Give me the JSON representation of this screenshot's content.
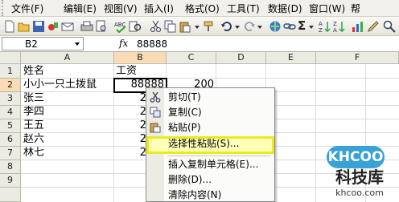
{
  "menubar": {
    "items": [
      {
        "label": "文件(F)",
        "name": "menu-file"
      },
      {
        "label": "编辑(E)",
        "name": "menu-edit"
      },
      {
        "label": "视图(V)",
        "name": "menu-view"
      },
      {
        "label": "插入(I)",
        "name": "menu-insert"
      },
      {
        "label": "格式(O)",
        "name": "menu-format"
      },
      {
        "label": "工具(T)",
        "name": "menu-tools"
      },
      {
        "label": "数据(D)",
        "name": "menu-data"
      },
      {
        "label": "窗口(W)",
        "name": "menu-window"
      },
      {
        "label": "帮",
        "name": "menu-help"
      }
    ]
  },
  "toolbar": {
    "icons": [
      "new-icon",
      "open-icon",
      "save-icon",
      "permission-icon",
      "email-icon",
      "print-icon",
      "print-preview-icon",
      "spelling-icon",
      "research-icon",
      "cut-icon",
      "copy-icon",
      "paste-icon",
      "format-painter-icon",
      "undo-icon",
      "redo-icon",
      "hyperlink-icon",
      "autosum-icon",
      "sort-ascending-icon",
      "sort-descending-icon"
    ],
    "sum_label": "Σ"
  },
  "formula_bar": {
    "name_box": "B2",
    "fx_label": "fx",
    "value": "88888"
  },
  "sheet": {
    "columns": [
      "A",
      "B",
      "C",
      "D",
      "E",
      "F"
    ],
    "selected_column": "B",
    "rows": [
      "1",
      "2",
      "3",
      "4",
      "5",
      "6",
      "7",
      "8",
      "9"
    ],
    "selected_row": "2",
    "cells": {
      "A1": "姓名",
      "B1": "工资",
      "A2": "小小一只土拨鼠",
      "B2": "88888",
      "C2": "200",
      "A3": "张三",
      "B3": "2",
      "A4": "李四",
      "B4": "2",
      "A5": "王五",
      "B5": "2",
      "A6": "赵六",
      "B6": "2",
      "A7": "林七",
      "B7": "2"
    }
  },
  "context_menu": {
    "items": [
      {
        "label": "剪切(T)",
        "icon": "scissors-icon"
      },
      {
        "label": "复制(C)",
        "icon": "copy-icon"
      },
      {
        "label": "粘贴(P)",
        "icon": "paste-icon"
      },
      {
        "label": "选择性粘贴(S)...",
        "icon": "",
        "highlighted": true
      },
      {
        "label": "插入复制单元格(E)...",
        "icon": ""
      },
      {
        "label": "删除(D)...",
        "icon": ""
      },
      {
        "label": "清除内容(N)",
        "icon": ""
      }
    ],
    "highlight_color": "#e8ec1c"
  },
  "watermark": {
    "logo": "KHCOO",
    "name": "科技库",
    "domain": "khcoo.com"
  },
  "colors": {
    "menubar_bg": "#f2f0ea",
    "header_bg": "#ebeae3",
    "header_selected_bg": "#f9dcb6",
    "highlight_fill": "#ffffb9"
  }
}
